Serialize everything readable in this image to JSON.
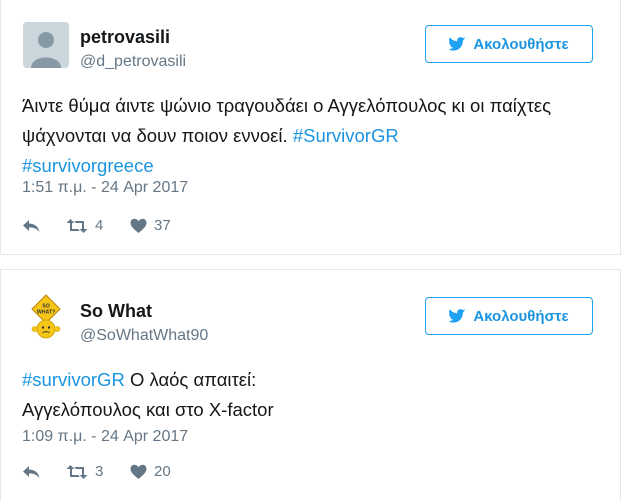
{
  "tweets": [
    {
      "display_name": "petrovasili",
      "handle": "@d_petrovasili",
      "follow_label": "Ακολουθήστε",
      "text_plain": "Άιντε θύμα άιντε ψώνιο τραγουδάει ο Αγγελόπουλος κι οι παίχτες ψάχνονται να δουν ποιον εννοεί. ",
      "hashtag_1": "#SurvivorGR",
      "hashtag_2": "#survivorgreece",
      "timestamp": "1:51 π.μ. - 24 Apr 2017",
      "retweets": "4",
      "likes": "37",
      "avatar_icon": "default-egg-avatar"
    },
    {
      "display_name": "So What",
      "handle": "@SoWhatWhat90",
      "follow_label": "Ακολουθήστε",
      "hashtag_1": "#survivorGR",
      "text_line1": " Ο λαός απαιτεί:",
      "text_line2": "Αγγελόπουλος και στο X-factor",
      "timestamp": "1:09 π.μ. - 24 Apr 2017",
      "retweets": "3",
      "likes": "20",
      "avatar_icon": "so-what-sign-avatar",
      "avatar_sign_text": "SO WHAT?"
    }
  ],
  "colors": {
    "link": "#1b95e0",
    "muted": "#657786",
    "text": "#14171a",
    "border": "#e1e8ed"
  }
}
